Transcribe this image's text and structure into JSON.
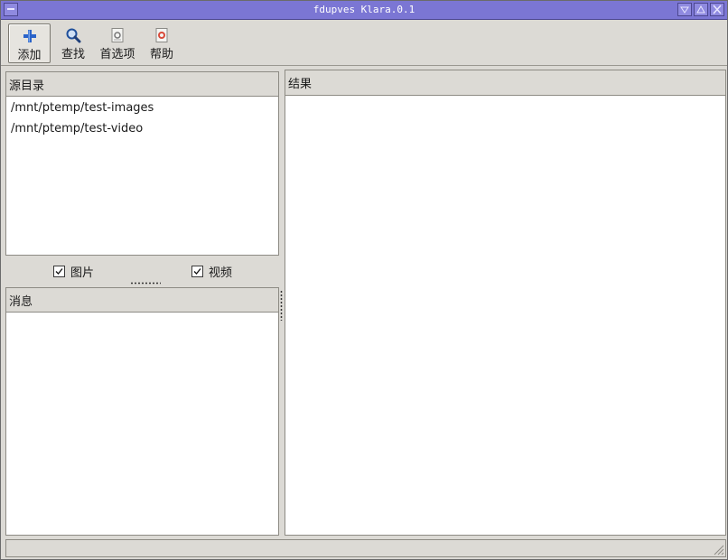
{
  "window": {
    "title": "fdupves Klara.0.1"
  },
  "toolbar": {
    "add_label": "添加",
    "find_label": "查找",
    "prefs_label": "首选项",
    "help_label": "帮助"
  },
  "sources": {
    "header": "源目录",
    "items": [
      "/mnt/ptemp/test-images",
      "/mnt/ptemp/test-video"
    ]
  },
  "filters": {
    "images_label": "图片",
    "images_checked": true,
    "video_label": "视频",
    "video_checked": true
  },
  "messages": {
    "header": "消息"
  },
  "results": {
    "header": "结果"
  },
  "icons": {
    "add": "plus-icon",
    "find": "magnifier-icon",
    "prefs": "preferences-icon",
    "help": "help-icon"
  }
}
